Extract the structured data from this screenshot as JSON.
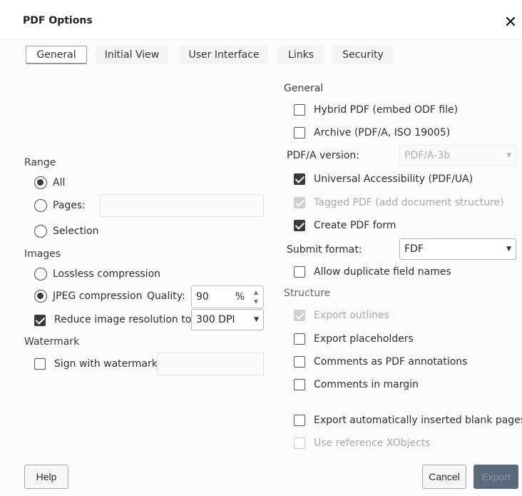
{
  "dialog": {
    "title": "PDF Options",
    "close": "✕"
  },
  "tabs": [
    "General",
    "Initial View",
    "User Interface",
    "Links",
    "Security"
  ],
  "range": {
    "header": "Range",
    "all": "All",
    "pages": "Pages:",
    "pages_value": "",
    "selection": "Selection"
  },
  "images": {
    "header": "Images",
    "lossless": "Lossless compression",
    "jpeg": "JPEG compression",
    "quality_label": "Quality:",
    "quality_value": "90",
    "quality_unit": "%",
    "reduce": "Reduce image resolution to:",
    "dpi_value": "300 DPI"
  },
  "watermark": {
    "header": "Watermark",
    "sign": "Sign with watermark",
    "value": ""
  },
  "general": {
    "header": "General",
    "hybrid": "Hybrid PDF (embed ODF file)",
    "archive": "Archive (PDF/A, ISO 19005)",
    "pdfa_version_label": "PDF/A version:",
    "pdfa_version_value": "PDF/A-3b",
    "universal": "Universal Accessibility (PDF/UA)",
    "tagged": "Tagged PDF (add document structure)",
    "create_form": "Create PDF form",
    "submit_label": "Submit format:",
    "submit_value": "FDF",
    "duplicate": "Allow duplicate field names"
  },
  "structure": {
    "header": "Structure",
    "outlines": "Export outlines",
    "placeholders": "Export placeholders",
    "comments_annot": "Comments as PDF annotations",
    "comments_margin": "Comments in margin",
    "blank_pages": "Export automatically inserted blank pages",
    "xobjects": "Use reference XObjects"
  },
  "buttons": {
    "help": "Help",
    "cancel": "Cancel",
    "export": "Export"
  }
}
